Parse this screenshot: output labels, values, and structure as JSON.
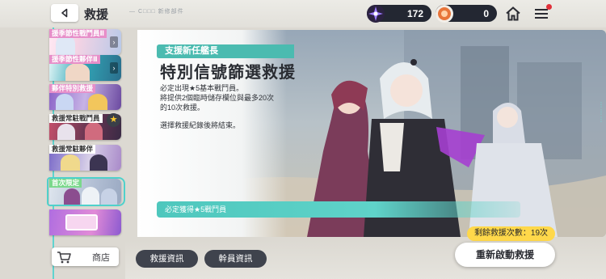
{
  "header": {
    "title": "救援",
    "deco_text": "— C□□□ 新修部件"
  },
  "resources": [
    {
      "name": "gem-currency",
      "value": "172",
      "color": "#7b5cff"
    },
    {
      "name": "ticket-currency",
      "value": "0",
      "color": "#e8753a"
    }
  ],
  "banners": [
    {
      "label": "援季節性戰鬥員Ⅱ",
      "label_style": "pink",
      "colors": [
        "#ffe9f3",
        "#b8c9e8"
      ]
    },
    {
      "label": "援季節性夥伴Ⅱ",
      "label_style": "pink",
      "colors": [
        "#33a8b8",
        "#2a6e8c"
      ]
    },
    {
      "label": "夥伴特別救援",
      "label_style": "pink",
      "colors": [
        "#8a63c7",
        "#c7b3e6"
      ]
    },
    {
      "label": "救援常駐戰鬥員",
      "label_style": "white",
      "colors": [
        "#c5506b",
        "#3a2a45"
      ]
    },
    {
      "label": "救援常駐夥伴",
      "label_style": "white",
      "colors": [
        "#7b6bc8",
        "#d7cfe8"
      ]
    },
    {
      "label": "首次限定",
      "label_style": "green",
      "colors": [
        "#dfe6ee",
        "#9aa9c2"
      ]
    },
    {
      "label": "",
      "label_style": "none",
      "colors": [
        "#b06ee0",
        "#e18bd7"
      ]
    }
  ],
  "shop": {
    "label": "商店"
  },
  "main": {
    "subtitle": "支援新任艦長",
    "title": "特別信號篩選救援",
    "desc_lines": [
      "必定出現★5基本戰鬥員。",
      "將提供2個臨時儲存欄位與最多20次",
      "的10次救援。",
      "",
      "選擇救援紀錄後將結束。"
    ],
    "guarantee": "必定獲得★5戰鬥員"
  },
  "bottom": {
    "rescue_info": "救援資訊",
    "staff_info": "幹員資訊",
    "remaining": "剩餘救援次數：19次",
    "restart": "重新啟動救援"
  },
  "colors": {
    "accent": "#4ec7bd",
    "panel_dark": "#3f434d",
    "gold": "#ffd84a"
  }
}
